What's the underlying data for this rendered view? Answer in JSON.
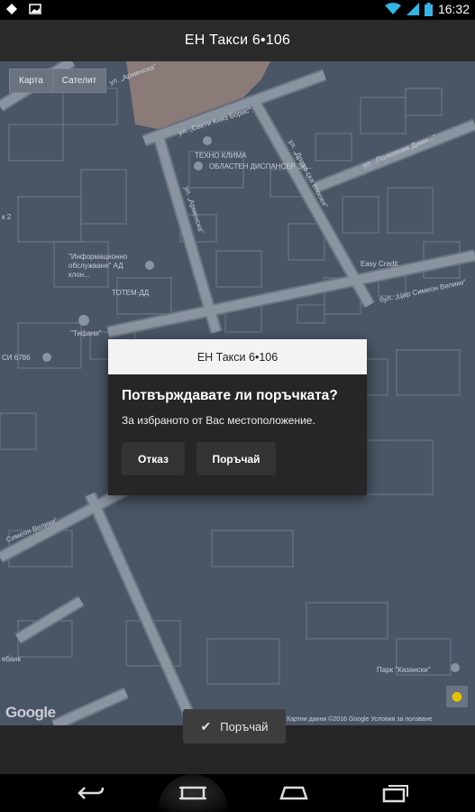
{
  "status_bar": {
    "time": "16:32",
    "icons": [
      "navigation-icon",
      "image-icon",
      "wifi-icon",
      "signal-icon",
      "battery-icon"
    ]
  },
  "action_bar": {
    "title": "ЕН Такси 6•106"
  },
  "map": {
    "map_type_buttons": [
      "Карта",
      "Сателит"
    ],
    "labels": {
      "street_1": "ул. „Арменска“",
      "street_2": "ул. „Свети Княз Борис“",
      "street_3": "ул. „Драва ска епопея“",
      "street_4": "ул. „Полковник Дими...“",
      "street_5": "ул. „Арменска“",
      "street_6": "бул. „Цар Симеон Велики“",
      "street_7": "Симеон Велики“",
      "poi_1": "ТЕХНО КЛИМА",
      "poi_2": "ОБЛАСТЕН ДИСПАНСЕР ЗА...",
      "poi_3": "\"Информационно обслужване\" АД клон...",
      "poi_4": "ТОТЕМ-ДД",
      "poi_5": "Easy Credit",
      "poi_6": "\"Тифани\"",
      "poi_7": "СИ 6786",
      "poi_8": "Парк \"Казански\"",
      "poi_9": "ебанк",
      "poi_10": "к 2"
    },
    "google_logo": "Google",
    "attribution": "Картни данни ©2016 Google   Условия за ползване",
    "colors": {
      "map_bg": "#4a5566",
      "road": "#8a93a0",
      "road_edge": "#6b7482"
    }
  },
  "dialog": {
    "header": "ЕН Такси 6•106",
    "title": "Потвърждавате ли поръчката?",
    "message": "За избраното от Вас местоположение.",
    "cancel_label": "Отказ",
    "order_label": "Поръчай"
  },
  "bottom_action": {
    "label": "Поръчай",
    "icon": "check-icon"
  },
  "nav_bar": {
    "buttons": [
      "back-icon",
      "home-icon",
      "recent-apps-icon"
    ]
  }
}
